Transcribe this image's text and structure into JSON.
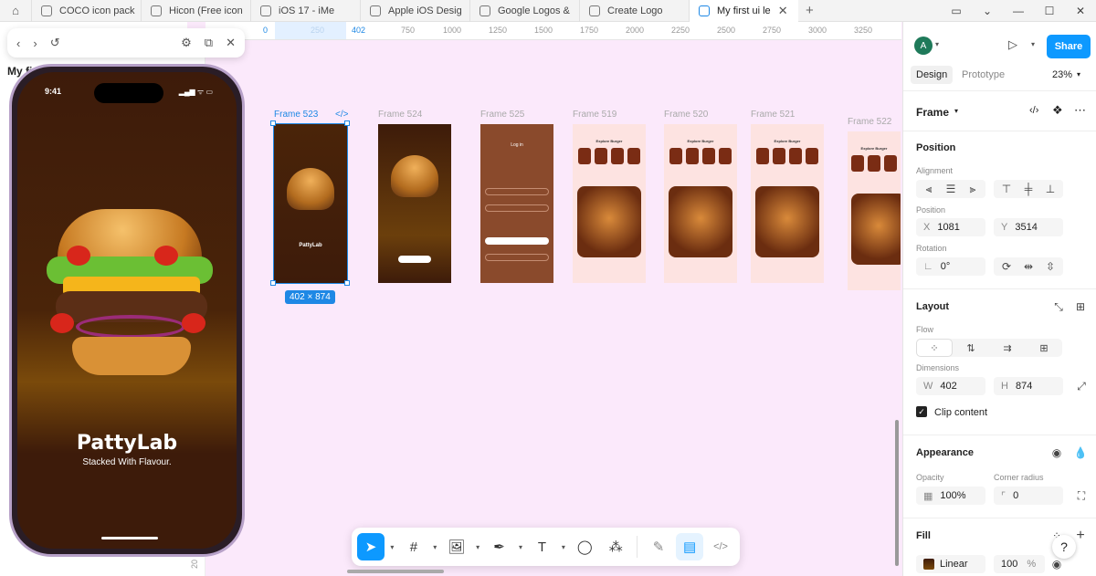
{
  "tabs": [
    {
      "label": "COCO icon pack"
    },
    {
      "label": "Hicon (Free icon"
    },
    {
      "label": "iOS 17 - iMe"
    },
    {
      "label": "Apple iOS Desig"
    },
    {
      "label": "Google Logos &"
    },
    {
      "label": "Create Logo"
    },
    {
      "label": "My first ui le"
    }
  ],
  "file": {
    "title": "My fi"
  },
  "ruler": {
    "ticks": [
      "0",
      "250",
      "402",
      "750",
      "1000",
      "1250",
      "1500",
      "1750",
      "2000",
      "2250",
      "2500",
      "2750",
      "3000",
      "3250"
    ],
    "vtick": "20"
  },
  "phone": {
    "time": "9:41",
    "status_icons": "▂▄▆ ᯤ ▭",
    "brand": "PattyLab",
    "tagline": "Stacked With Flavour."
  },
  "frames": [
    {
      "label": "Frame 523"
    },
    {
      "label": "Frame 524"
    },
    {
      "label": "Frame 525"
    },
    {
      "label": "Frame 519"
    },
    {
      "label": "Frame 520"
    },
    {
      "label": "Frame 521"
    },
    {
      "label": "Frame 522"
    }
  ],
  "selection": {
    "dimensions": "402 × 874",
    "code_icon": "</>"
  },
  "mini": {
    "f1_brand": "PattyLab",
    "f3_title": "Log in",
    "app_title": "Explore Burger"
  },
  "panel": {
    "avatar": "A",
    "share": "Share",
    "tab_design": "Design",
    "tab_prototype": "Prototype",
    "zoom": "23%",
    "frame_label": "Frame",
    "position": "Position",
    "alignment": "Alignment",
    "position_sub": "Position",
    "x_label": "X",
    "x_value": "1081",
    "y_label": "Y",
    "y_value": "3514",
    "rotation": "Rotation",
    "rotation_value": "0°",
    "layout": "Layout",
    "flow": "Flow",
    "dimensions": "Dimensions",
    "w_label": "W",
    "w_value": "402",
    "h_label": "H",
    "h_value": "874",
    "clip_content": "Clip content",
    "appearance": "Appearance",
    "opacity": "Opacity",
    "opacity_value": "100%",
    "corner_radius": "Corner radius",
    "corner_value": "0",
    "fill": "Fill",
    "fill_type": "Linear",
    "fill_value": "100",
    "fill_pct": "%"
  },
  "toolbar": {
    "code": "</>"
  },
  "help": "?"
}
